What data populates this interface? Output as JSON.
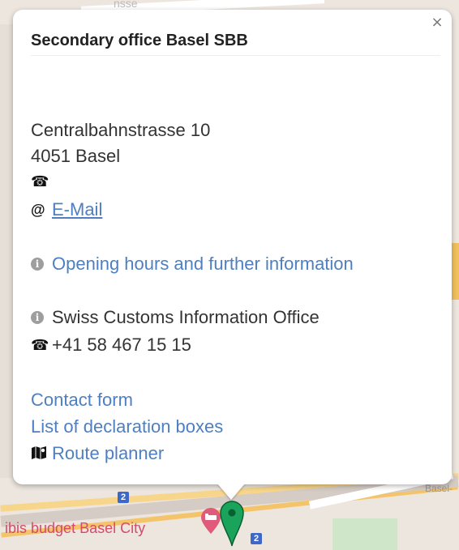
{
  "map": {
    "street_fragment": "nsse",
    "shield_numbers": [
      "2",
      "2"
    ],
    "corner_label": "Basel-",
    "poi_label": "ibis budget Basel City",
    "colors": {
      "marker": "#1aa35a",
      "hotel": "#e05a7a",
      "shield": "#3d67c9"
    },
    "icons": [
      "hotel-pin-icon",
      "green-map-marker-icon"
    ]
  },
  "popup": {
    "close_label": "×",
    "title": "Secondary office Basel SBB",
    "address_line1": "Centralbahnstrasse 10",
    "address_line2": "4051 Basel",
    "phone_icon": "☎",
    "email_icon": "@",
    "email_link": "E-Mail",
    "opening_hours_link": "Opening hours and further information",
    "info_office": "Swiss Customs Information Office",
    "info_office_phone": "+41 58 467 15 15",
    "contact_form_link": "Contact form",
    "declaration_boxes_link": "List of declaration boxes",
    "route_icon": "map-icon",
    "route_planner_link": "Route planner",
    "colors": {
      "link": "#4e7fc0",
      "text": "#333333",
      "title": "#222222"
    }
  }
}
